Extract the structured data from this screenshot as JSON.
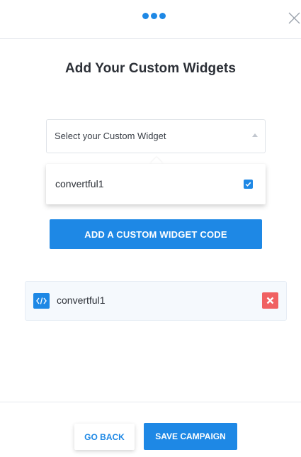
{
  "header": {
    "progress_icon": "more-dots-icon",
    "close_icon": "close-icon"
  },
  "page_title": "Add Your Custom Widgets",
  "widget_select": {
    "value": "Select your Custom Widget",
    "state": "open",
    "caret_icon": "caret-up-icon"
  },
  "dropdown": {
    "options": [
      {
        "label": "convertful1",
        "checked": true
      }
    ]
  },
  "add_code_button": "ADD A CUSTOM WIDGET CODE",
  "widget_list": [
    {
      "label": "convertful1",
      "icon": "code-icon",
      "remove_icon": "close-x-icon"
    }
  ],
  "footer": {
    "back_label": "GO BACK",
    "save_label": "SAVE CAMPAIGN"
  },
  "colors": {
    "accent": "#1e88e5",
    "danger": "#f06162",
    "item_background": "#f5f9fd",
    "text": "#2b2f36"
  }
}
